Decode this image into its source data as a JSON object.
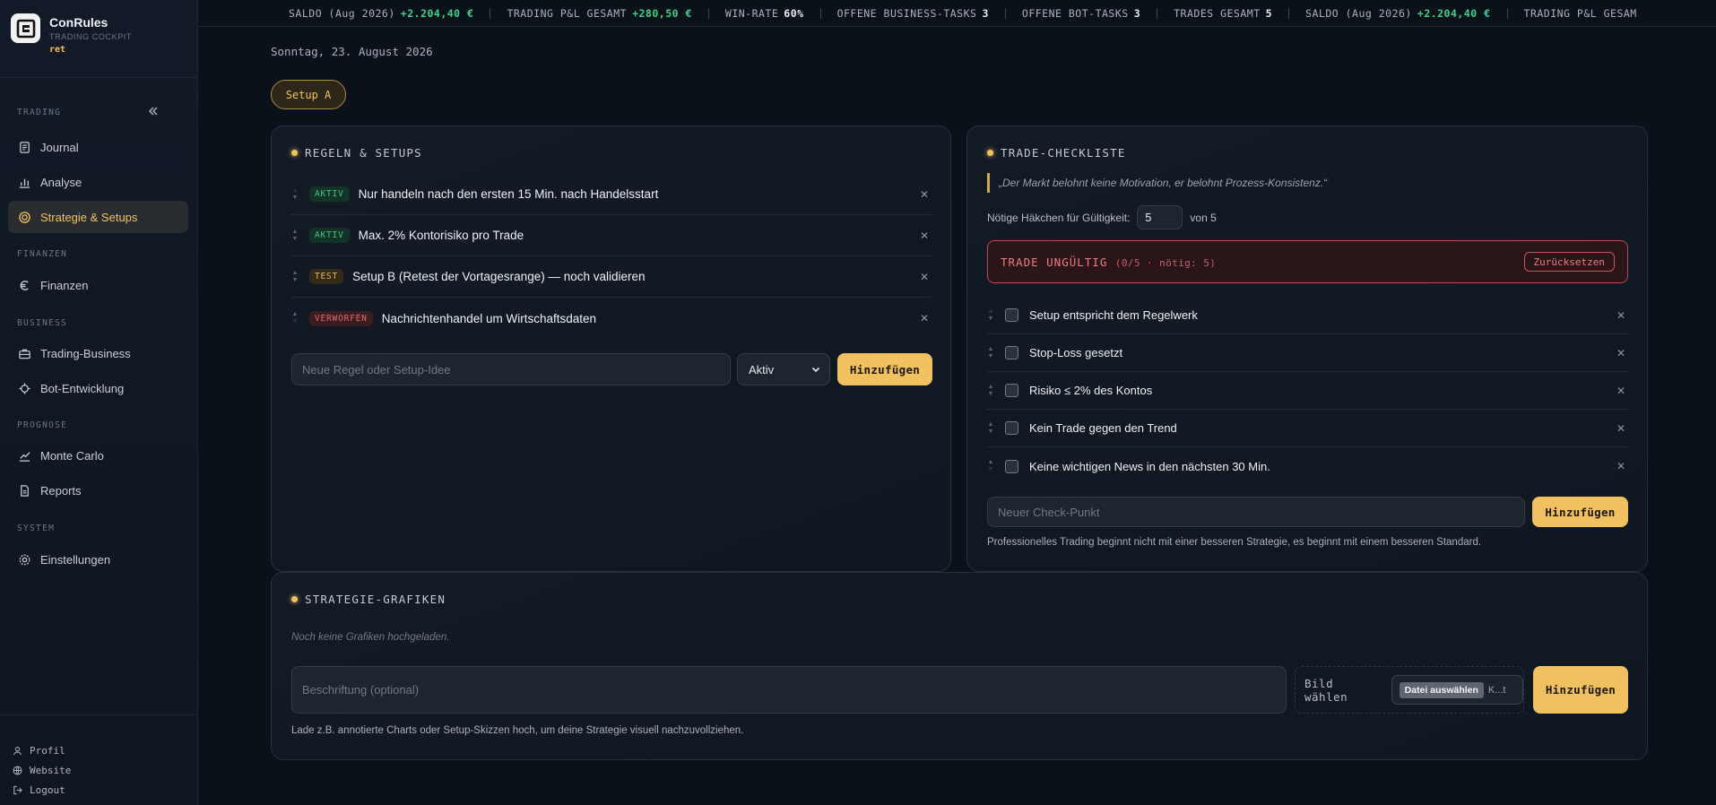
{
  "brand": {
    "name": "ConRules",
    "subtitle": "TRADING COCKPIT",
    "user": "ret"
  },
  "sidebar": {
    "sections": [
      {
        "label": "TRADING"
      },
      {
        "label": "FINANZEN"
      },
      {
        "label": "BUSINESS"
      },
      {
        "label": "PROGNOSE"
      },
      {
        "label": "SYSTEM"
      }
    ],
    "items": [
      {
        "label": "Journal",
        "icon": "journal-icon"
      },
      {
        "label": "Analyse",
        "icon": "chart-bar-icon"
      },
      {
        "label": "Strategie & Setups",
        "icon": "target-icon",
        "active": true
      },
      {
        "label": "Finanzen",
        "icon": "euro-icon"
      },
      {
        "label": "Trading-Business",
        "icon": "briefcase-icon"
      },
      {
        "label": "Bot-Entwicklung",
        "icon": "bot-icon"
      },
      {
        "label": "Monte Carlo",
        "icon": "line-chart-icon"
      },
      {
        "label": "Reports",
        "icon": "document-icon"
      },
      {
        "label": "Einstellungen",
        "icon": "gear-icon"
      }
    ],
    "footer": [
      {
        "label": "Profil",
        "icon": "user-icon"
      },
      {
        "label": "Website",
        "icon": "globe-icon"
      },
      {
        "label": "Logout",
        "icon": "logout-icon"
      }
    ]
  },
  "ticker": [
    {
      "label": "SALDO (Aug 2026)",
      "value": "+2.204,40 €",
      "positive": true
    },
    {
      "label": "TRADING P&L GESAMT",
      "value": "+280,50 €",
      "positive": true
    },
    {
      "label": "WIN-RATE",
      "value": "60%",
      "positive": false
    },
    {
      "label": "OFFENE BUSINESS-TASKS",
      "value": "3",
      "positive": false
    },
    {
      "label": "OFFENE BOT-TASKS",
      "value": "3",
      "positive": false
    },
    {
      "label": "TRADES GESAMT",
      "value": "5",
      "positive": false
    },
    {
      "label": "SALDO (Aug 2026)",
      "value": "+2.204,40 €",
      "positive": true
    },
    {
      "label": "TRADING P&L GESAM",
      "value": "",
      "positive": false
    }
  ],
  "date": "Sonntag, 23. August 2026",
  "setup_chip": "Setup A",
  "rules": {
    "title": "REGELN & SETUPS",
    "items": [
      {
        "status": "AKTIV",
        "status_key": "aktiv",
        "text": "Nur handeln nach den ersten 15 Min. nach Handelsstart"
      },
      {
        "status": "AKTIV",
        "status_key": "aktiv",
        "text": "Max. 2% Kontorisiko pro Trade"
      },
      {
        "status": "TEST",
        "status_key": "test",
        "text": "Setup B (Retest der Vortagesrange) — noch validieren"
      },
      {
        "status": "VERWORFEN",
        "status_key": "verworfen",
        "text": "Nachrichtenhandel um Wirtschaftsdaten"
      }
    ],
    "input_placeholder": "Neue Regel oder Setup-Idee",
    "select_value": "Aktiv",
    "add_label": "Hinzufügen"
  },
  "checklist": {
    "title": "TRADE-CHECKLISTE",
    "quote": "„Der Markt belohnt keine Motivation, er belohnt Prozess-Konsistenz.“",
    "required_label": "Nötige Häkchen für Gültigkeit:",
    "required_value": "5",
    "required_of": "von 5",
    "status_text": "TRADE UNGÜLTIG",
    "status_sub": "(0/5 · nötig: 5)",
    "reset_label": "Zurücksetzen",
    "items": [
      {
        "text": "Setup entspricht dem Regelwerk",
        "checked": false
      },
      {
        "text": "Stop-Loss gesetzt",
        "checked": false
      },
      {
        "text": "Risiko ≤ 2% des Kontos",
        "checked": false
      },
      {
        "text": "Kein Trade gegen den Trend",
        "checked": false
      },
      {
        "text": "Keine wichtigen News in den nächsten 30 Min.",
        "checked": false
      }
    ],
    "input_placeholder": "Neuer Check-Punkt",
    "add_label": "Hinzufügen",
    "footer_note": "Professionelles Trading beginnt nicht mit einer besseren Strategie, es beginnt mit einem besseren Standard."
  },
  "graphics": {
    "title": "STRATEGIE-GRAFIKEN",
    "empty_note": "Noch keine Grafiken hochgeladen.",
    "caption_placeholder": "Beschriftung (optional)",
    "file_label": "Bild wählen",
    "file_button": "Datei auswählen",
    "file_status": "K...t",
    "add_label": "Hinzufügen",
    "footer_note": "Lade z.B. annotierte Charts oder Setup-Skizzen hoch, um deine Strategie visuell nachzuvollziehen."
  },
  "colors": {
    "accent": "#f2c15f",
    "positive": "#39d08e",
    "danger": "#ef7b80",
    "background": "#0b1119"
  }
}
